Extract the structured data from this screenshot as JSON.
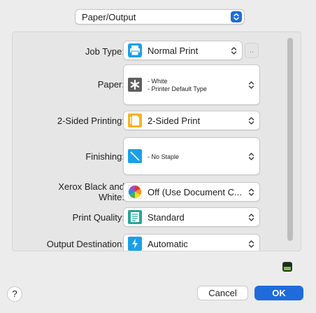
{
  "section": {
    "value": "Paper/Output"
  },
  "rows": {
    "job_type": {
      "label": "Job Type:",
      "value": "Normal Print",
      "dots": ".."
    },
    "paper": {
      "label": "Paper:",
      "line1": "- White",
      "line2": "- Printer Default Type"
    },
    "two_sided": {
      "label": "2-Sided Printing:",
      "value": "2-Sided Print"
    },
    "finishing": {
      "label": "Finishing:",
      "value": "- No Staple"
    },
    "xerox_bw": {
      "label_line1": "Xerox Black and",
      "label_line2": "White:",
      "value": "Off (Use Document C..."
    },
    "print_quality": {
      "label": "Print Quality:",
      "value": "Standard"
    },
    "output_destination": {
      "label": "Output Destination:",
      "value": "Automatic"
    }
  },
  "footer": {
    "help": "?",
    "cancel": "Cancel",
    "ok": "OK"
  },
  "icons": {
    "job_type": "printer-icon",
    "paper": "paper-asterisk-icon",
    "two_sided": "two-sided-document-icon",
    "finishing": "no-staple-icon",
    "xerox_bw": "color-wheel-icon",
    "print_quality": "quality-document-icon",
    "output_destination": "output-tray-icon",
    "status": "toner-status-icon"
  },
  "colors": {
    "accent": "#1f6bdc",
    "icon_blue": "#1aa0e8",
    "icon_yellow": "#f4b428",
    "icon_teal": "#2aa59a"
  }
}
